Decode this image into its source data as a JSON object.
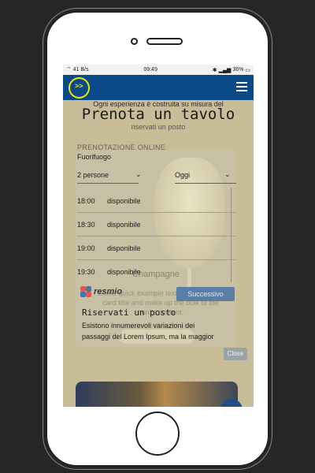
{
  "status_bar": {
    "left": "41 B/s",
    "time": "09:49",
    "right": "36%"
  },
  "header": {
    "logo_icon": "lightbulb-logo-icon",
    "menu_icon": "hamburger-menu-icon",
    "brand_color": "#0b4a87",
    "accent_color": "#f5e600"
  },
  "page": {
    "intro_line": "Ogni esperienza è costruita su misura del",
    "intro_line2": "riservati un posto",
    "title": "Prenota un tavolo"
  },
  "hero_card": {
    "title": "Champagne",
    "body": "Some quick example text to build on the card title and make up the bulk of the card's content."
  },
  "booking": {
    "section_label": "PRENOTAZIONE ONLINE",
    "venue": "Fuorifuogo",
    "party_select": "2 persone",
    "date_select": "Oggi",
    "slots": [
      {
        "time": "18:00",
        "status": "disponibile"
      },
      {
        "time": "18:30",
        "status": "disponibile"
      },
      {
        "time": "19:00",
        "status": "disponibile"
      },
      {
        "time": "19:30",
        "status": "disponibile"
      }
    ],
    "provider": "resmio",
    "next_label": "Successivo"
  },
  "modal": {
    "title": "Riservati un posto",
    "body": "Esistono innumerevoli variazioni dei passaggi del Lorem Ipsum, ma la maggior",
    "close_label": "Close"
  }
}
